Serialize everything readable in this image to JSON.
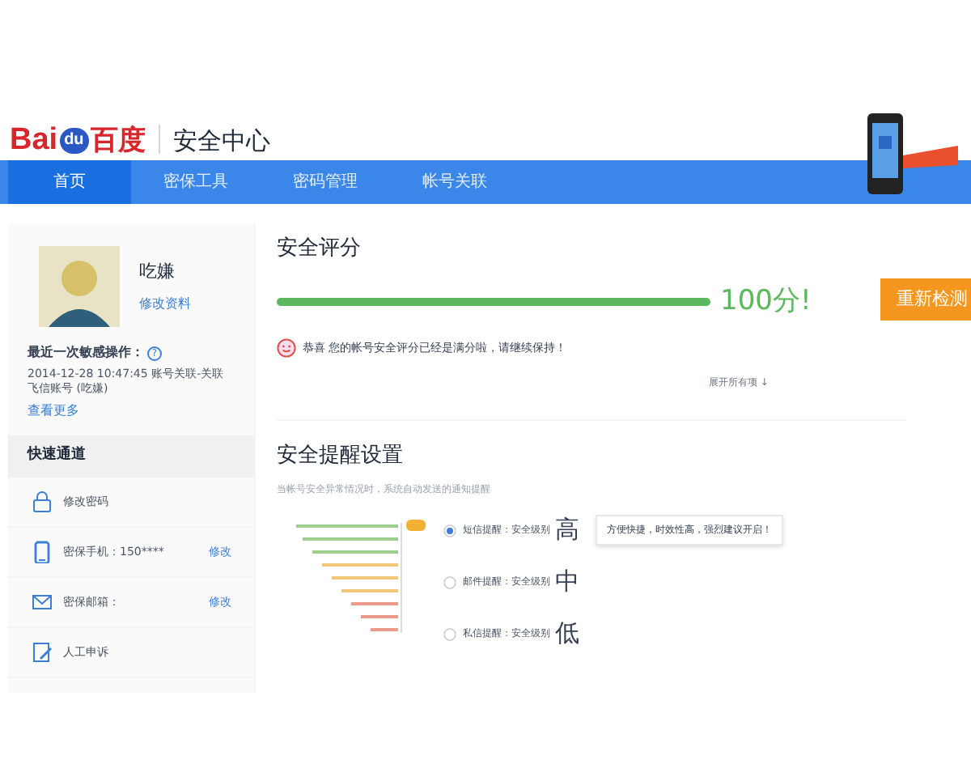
{
  "header": {
    "logo": {
      "text_1": "Bai",
      "text_2": "du",
      "text_3": "百度"
    },
    "site_title": "安全中心"
  },
  "nav": [
    {
      "label": "首页",
      "selected": true
    },
    {
      "label": "密保工具",
      "selected": false
    },
    {
      "label": "密码管理",
      "selected": false
    },
    {
      "label": "帐号关联",
      "selected": false
    }
  ],
  "profile": {
    "username": "吃嫌",
    "edit_link": "修改资料",
    "recent_label": "最近一次敏感操作：",
    "help": "?",
    "recent_detail": "2014-12-28 10:47:45  账号关联-关联飞信账号 (吃嫌)",
    "more_link": "查看更多"
  },
  "quick_access": {
    "title": "快速通道",
    "items": [
      {
        "kind": "lock",
        "label": "修改密码"
      },
      {
        "kind": "phone",
        "label": "密保手机：150****",
        "action": "修改"
      },
      {
        "kind": "mail",
        "label": "密保邮箱：",
        "action": "修改"
      },
      {
        "kind": "edit",
        "label": "人工申诉"
      }
    ]
  },
  "score": {
    "title": "安全评分",
    "level": 1.0,
    "value": "100分!",
    "button": "重新检测",
    "message": "恭喜 您的帐号安全评分已经是满分啦，请继续保持！",
    "expand": "展开所有项 ↓"
  },
  "alerts": {
    "title": "安全提醒设置",
    "subtitle": "当帐号安全异常情况时，系统自动发送的通知提醒",
    "options": [
      {
        "label": "短信提醒：安全级别",
        "grade": "高",
        "selected": true,
        "tip": "方便快捷，时效性高，强烈建议开启！"
      },
      {
        "label": "邮件提醒：安全级别",
        "grade": "中",
        "selected": false
      },
      {
        "label": "私信提醒：安全级别",
        "grade": "低",
        "selected": false
      }
    ]
  }
}
